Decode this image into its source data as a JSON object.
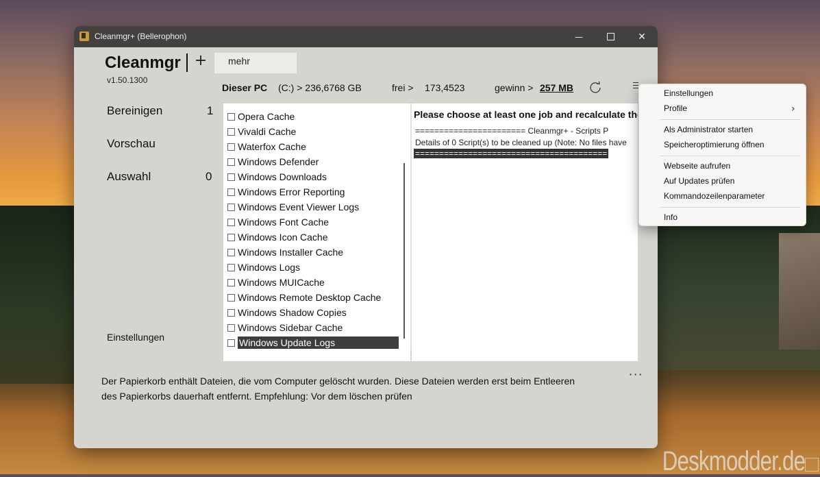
{
  "window": {
    "title": "Cleanmgr+ (Bellerophon)",
    "minimize": "—",
    "close": "✕"
  },
  "header": {
    "app_name": "Cleanmgr",
    "plus": "+",
    "tab_label": "mehr",
    "version": "v1.50.1300"
  },
  "topbar": {
    "pc_label": "Dieser PC",
    "drive": "(C:) > 236,6768 GB",
    "frei_label": "frei >",
    "frei_value": "173,4523",
    "gewinn_label": "gewinn >",
    "gewinn_value": "257 MB"
  },
  "nav": {
    "items": [
      {
        "label": "Bereinigen",
        "count": "1"
      },
      {
        "label": "Vorschau",
        "count": ""
      },
      {
        "label": "Auswahl",
        "count": "0"
      }
    ],
    "settings": "Einstellungen"
  },
  "list": {
    "items": [
      "Opera Cache",
      "Vivaldi Cache",
      "Waterfox Cache",
      "Windows Defender",
      "Windows Downloads",
      "Windows Error Reporting",
      "Windows Event Viewer Logs",
      "Windows Font Cache",
      "Windows Icon Cache",
      "Windows Installer Cache",
      "Windows Logs",
      "Windows MUICache",
      "Windows Remote Desktop Cache",
      "Windows Shadow Copies",
      "Windows Sidebar Cache",
      "Windows Update Logs"
    ],
    "selected": "Windows Update Logs"
  },
  "output": {
    "heading": "Please choose at least one job and recalculate the",
    "line1": "======================= Cleanmgr+ - Scripts P",
    "line2": "Details of 0 Script(s) to be cleaned up (Note: No files have",
    "line3": "========================================"
  },
  "footer": {
    "description": "Der Papierkorb enthält Dateien, die vom Computer gelöscht wurden. Diese Dateien werden erst beim Entleeren des Papierkorbs dauerhaft entfernt. Empfehlung: Vor dem löschen prüfen",
    "more": "···"
  },
  "context_menu": {
    "items": [
      "Einstellungen",
      "Profile",
      "Als Administrator starten",
      "Speicheroptimierung öffnen",
      "Webseite aufrufen",
      "Auf Updates prüfen",
      "Kommandozeilenparameter",
      "Info"
    ],
    "chevron": "›"
  },
  "watermark": "Deskmodder.de"
}
